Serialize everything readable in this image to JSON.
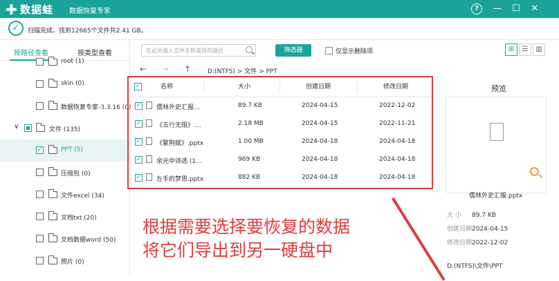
{
  "app": {
    "brand": "数据蛙",
    "subtitle": "数据恢复专家",
    "help": "?",
    "minimize": "—",
    "maximize": "☐",
    "close": "✕"
  },
  "status": {
    "text": "扫描完成。找到12665个文件共2.41 GB。"
  },
  "left_tabs": {
    "by_path": "按路径查看",
    "by_type": "按类型查看"
  },
  "tree": [
    {
      "label": "root (1)",
      "checked": false
    },
    {
      "label": "skin (0)",
      "checked": false
    },
    {
      "label": "数据恢复专家-3.3.16 (0)",
      "checked": false
    },
    {
      "label": "文件 (135)",
      "checked": "partial",
      "expanded": true
    },
    {
      "label": "PPT (5)",
      "checked": true,
      "selected": true
    },
    {
      "label": "压缩包 (0)",
      "checked": false
    },
    {
      "label": "文件excel (34)",
      "checked": false
    },
    {
      "label": "文档txt (20)",
      "checked": false
    },
    {
      "label": "文档数据word (50)",
      "checked": false
    },
    {
      "label": "照片 (0)",
      "checked": false
    }
  ],
  "toolbar": {
    "search_placeholder": "在此处输入文件名称或保存路径",
    "filter_label": "筛选器",
    "show_deleted_label": "仅显示删除项"
  },
  "nav": {
    "back": "←",
    "forward": "→",
    "up": "↑",
    "path": "D:(NTFS) > 文件 > PPT"
  },
  "table": {
    "headers": {
      "name": "名称",
      "size": "大小",
      "created": "创建日期",
      "modified": "修改日期"
    },
    "rows": [
      {
        "name": "儒林外史汇报...",
        "size": "89.7 KB",
        "created": "2024-04-15",
        "modified": "2022-12-02"
      },
      {
        "name": "《五行无阻》....",
        "size": "2.18 MB",
        "created": "2024-04-15",
        "modified": "2022-11-21"
      },
      {
        "name": "《繁荆赋》.pptx",
        "size": "1.00 MB",
        "created": "2024-04-18",
        "modified": "2024-04-18"
      },
      {
        "name": "余光中诗选 (1...",
        "size": "969 KB",
        "created": "2024-04-18",
        "modified": "2024-04-18"
      },
      {
        "name": "左手的梦思.pptx",
        "size": "882 KB",
        "created": "2024-04-18",
        "modified": "2024-04-18"
      }
    ]
  },
  "preview": {
    "title": "预览",
    "filename": "儒林外史汇报.pptx",
    "size_label": "大 小",
    "size": "89.7 KB",
    "created_label": "创建日期",
    "created": "2024-04-15",
    "modified_label": "修改日期",
    "modified": "2022-12-02",
    "path": "D:(NTFS)\\文件\\PPT"
  },
  "annotation": {
    "line1": "根据需要选择要恢复的数据",
    "line2": "将它们导出到另一硬盘中",
    "color": "#e03c3c"
  },
  "colors": {
    "accent": "#1aa39a",
    "highlight": "#e03c3c"
  }
}
